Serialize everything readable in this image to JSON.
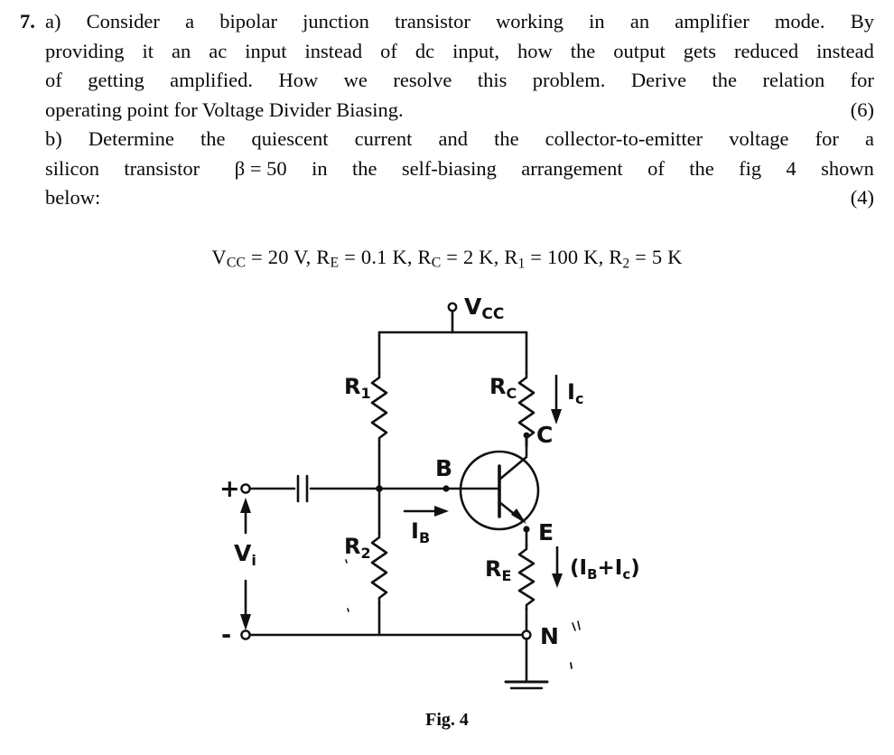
{
  "question": {
    "number": "7.",
    "part_a": {
      "label": "a)",
      "lines": [
        "a) Consider a bipolar junction transistor working in an amplifier mode. By",
        "providing it an ac input instead of dc input, how the output gets reduced instead",
        "of getting amplified. How we resolve this problem. Derive the relation for",
        "operating point for Voltage Divider Biasing."
      ],
      "marks": "(6)"
    },
    "part_b": {
      "label": "b)",
      "lines": [
        "b) Determine the quiescent current and the collector-to-emitter voltage for a",
        "silicon transistor   β = 50 in the self-biasing arrangement of the fig 4 shown",
        "below:"
      ],
      "marks": "(4)"
    },
    "values_line": "Vᴄᴄ = 20 V, Rᴇ = 0.1 K, Rᴄ = 2 K, R₁ = 100 K, R₂ = 5 K",
    "values": {
      "vcc": "20 V",
      "re": "0.1 K",
      "rc": "2 K",
      "r1": "100 K",
      "r2": "5 K",
      "beta": "50"
    }
  },
  "figure": {
    "caption": "Fig. 4",
    "labels": {
      "vcc": "V",
      "vcc_sub": "CC",
      "r1": "R",
      "r1_sub": "1",
      "r2": "R",
      "r2_sub": "2",
      "rc": "R",
      "rc_sub": "C",
      "re": "R",
      "re_sub": "E",
      "ic": "I",
      "ic_sub": "c",
      "ib": "I",
      "ib_sub": "B",
      "base": "B",
      "collector": "C",
      "emitter": "E",
      "node_n": "N",
      "vi": "V",
      "vi_sub": "i",
      "plus": "+",
      "minus": "-",
      "emitter_current": "(Iʙ+Iꟲ)"
    },
    "colors": {
      "ink": "#111111",
      "paper": "#ffffff"
    }
  }
}
